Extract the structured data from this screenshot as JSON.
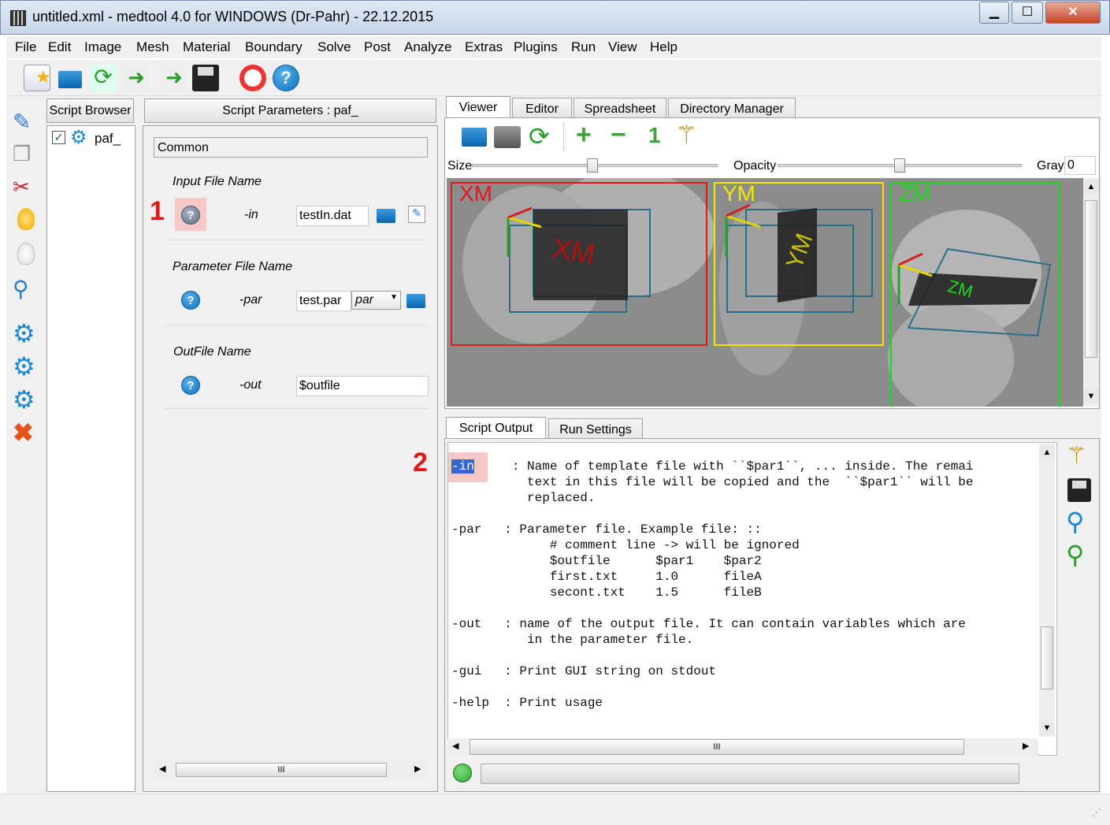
{
  "window": {
    "title": "untitled.xml - medtool 4.0 for WINDOWS (Dr-Pahr) - 22.12.2015",
    "minimize": "▁",
    "maximize": "☐",
    "close": "✕"
  },
  "menu": [
    "File",
    "Edit",
    "Image",
    "Mesh",
    "Material",
    "Boundary",
    "Solve",
    "Post",
    "Analyze",
    "Extras",
    "Plugins",
    "Run",
    "View",
    "Help"
  ],
  "script_browser": {
    "title": "Script Browser",
    "item": "paf_"
  },
  "script_params": {
    "title": "Script Parameters : paf_",
    "section": "Common",
    "groups": [
      {
        "label": "Input File Name",
        "flag": "-in",
        "value": "testIn.dat"
      },
      {
        "label": "Parameter File Name",
        "flag": "-par",
        "value": "test.par",
        "select": "par"
      },
      {
        "label": "OutFile Name",
        "flag": "-out",
        "value": "$outfile"
      }
    ],
    "scroll_grip": "III"
  },
  "annotations": {
    "one": "1",
    "two": "2"
  },
  "viewer": {
    "tabs": [
      "Viewer",
      "Editor",
      "Spreadsheet",
      "Directory Manager"
    ],
    "zoom_reset": "1",
    "size_label": "Size",
    "size_level": 0.49,
    "opacity_label": "Opacity",
    "opacity_level": 0.5,
    "gray_label": "Gray",
    "gray_value": "0",
    "views": [
      {
        "label": "XM",
        "color": "#e8151a",
        "slice_text": "XM"
      },
      {
        "label": "YM",
        "color": "#f2e600",
        "slice_text": "YM"
      },
      {
        "label": "ZM",
        "color": "#18d918",
        "slice_text": "ZM"
      }
    ]
  },
  "output": {
    "tabs": [
      "Script Output",
      "Run Settings"
    ],
    "highlight": "-in",
    "line1_rest": "     : Name of template file with ``$par1``, ... inside. The remai",
    "text_rest": "          text in this file will be copied and the  ``$par1`` will be\n          replaced.\n\n-par   : Parameter file. Example file: ::\n             # comment line -> will be ignored\n             $outfile      $par1    $par2\n             first.txt     1.0      fileA\n             secont.txt    1.5      fileB\n\n-out   : name of the output file. It can contain variables which are\n          in the parameter file.\n\n-gui   : Print GUI string on stdout\n\n-help  : Print usage",
    "scroll_grip": "III",
    "status_color": "#2fa52f"
  }
}
